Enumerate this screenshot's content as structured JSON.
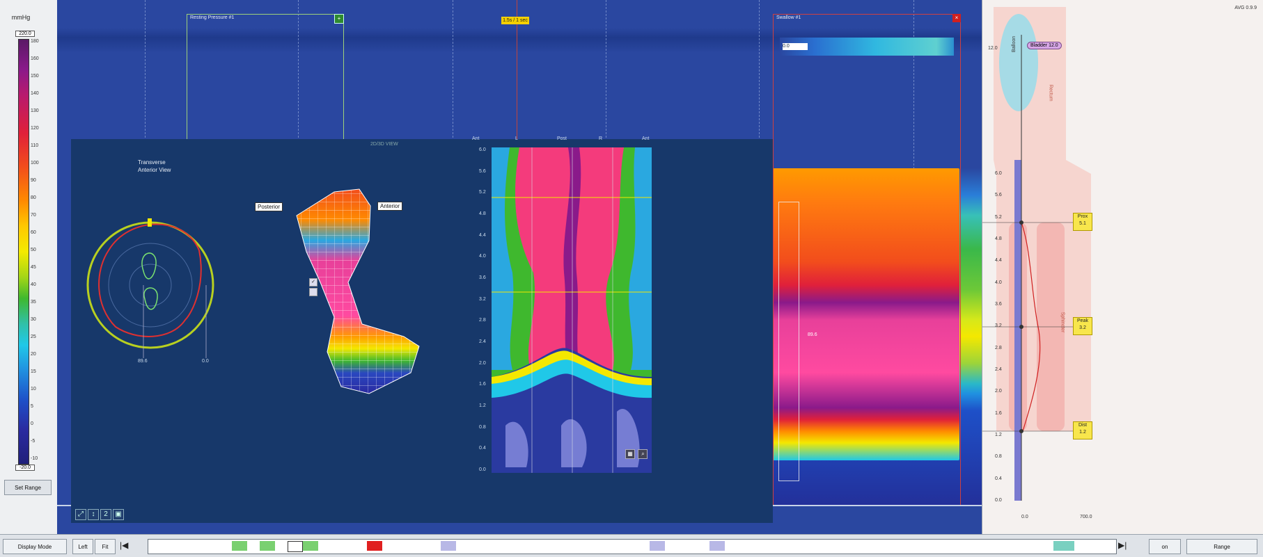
{
  "colorscale": {
    "unit": "mmHg",
    "max_value": "220.0",
    "min_value": "-20.0",
    "ticks": [
      "180",
      "160",
      "150",
      "140",
      "130",
      "120",
      "110",
      "100",
      "90",
      "80",
      "70",
      "60",
      "50",
      "45",
      "40",
      "35",
      "30",
      "25",
      "20",
      "15",
      "10",
      "5",
      "0",
      "-5",
      "-10"
    ],
    "set_range_label": "Set Range"
  },
  "main": {
    "annotation1_label": "Resting Pressure #1",
    "time_badge": "1.5s / 1 sec",
    "annotation2_label": "Swallow #1",
    "strip_value": "0.0",
    "cursor_value": "89.6"
  },
  "overlay": {
    "title": "2D/3D VIEW",
    "legend_line1": "Transverse",
    "legend_line2": "Anterior View",
    "posterior_label": "Posterior",
    "anterior_label": "Anterior",
    "polar_label_left": "89.6",
    "polar_label_right": "0.0",
    "spatio_top_labels": [
      "Ant",
      "L",
      "Post",
      "R",
      "Ant"
    ],
    "spatio_y_labels": [
      "6.0",
      "5.6",
      "5.2",
      "4.8",
      "4.4",
      "4.0",
      "3.6",
      "3.2",
      "2.8",
      "2.4",
      "2.0",
      "1.6",
      "1.2",
      "0.8",
      "0.4",
      "0.0"
    ]
  },
  "right": {
    "corner_label": "AVG 0.9.9",
    "balloon_label": "Balloon",
    "bladder_value": "12.0",
    "bladder_badge": "Bladder 12.0",
    "rectum_label": "Rectum",
    "sphincter_label": "Sphincter",
    "y_ticks": [
      "6.0",
      "5.6",
      "5.2",
      "4.8",
      "4.4",
      "4.0",
      "3.6",
      "3.2",
      "2.8",
      "2.4",
      "2.0",
      "1.6",
      "1.2",
      "0.8",
      "0.4",
      "0.0"
    ],
    "marker_prox_label": "Prox",
    "marker_prox_value": "5.1",
    "marker_peak_label": "Peak",
    "marker_peak_value": "3.2",
    "marker_dist_label": "Dist",
    "marker_dist_value": "1.2",
    "x_left": "0.0",
    "x_right": "700.0"
  },
  "toolbar": {
    "display_mode": "Display Mode",
    "btn_left": "Left",
    "btn_fit": "Fit",
    "btn_prev": "|◀",
    "btn_next": "▶|",
    "btn_on": "on",
    "btn_range": "Range"
  }
}
